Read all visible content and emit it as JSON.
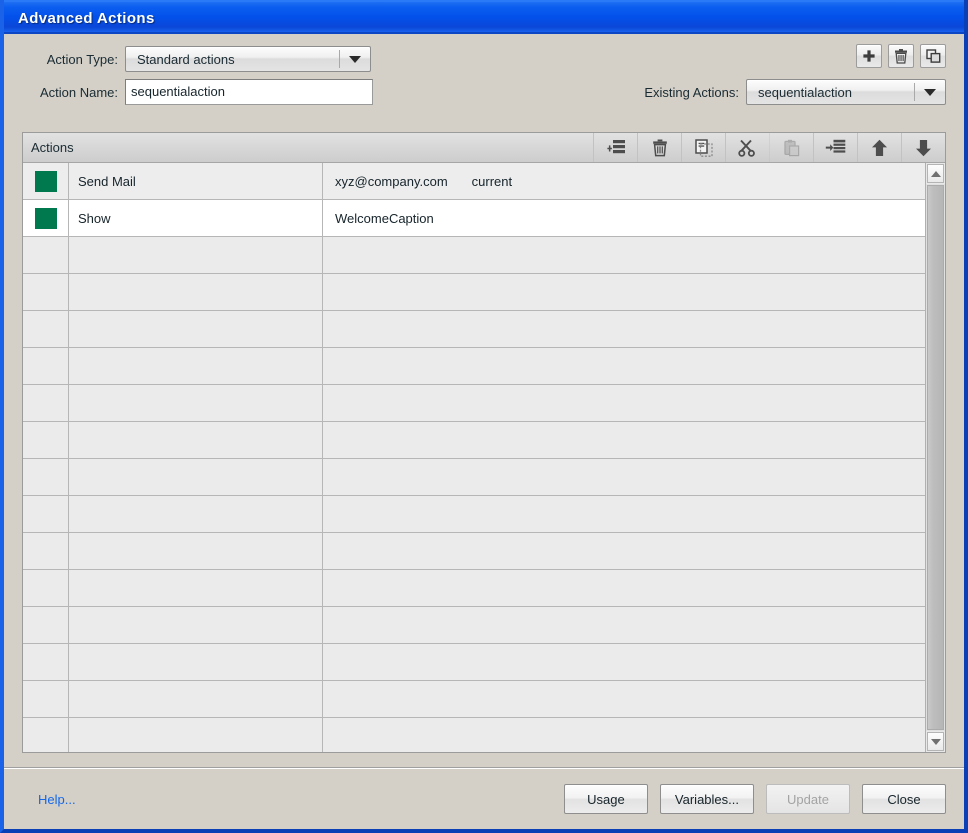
{
  "window": {
    "title": "Advanced Actions"
  },
  "form": {
    "action_type_label": "Action Type:",
    "action_type_value": "Standard actions",
    "action_name_label": "Action Name:",
    "action_name_value": "sequentialaction",
    "existing_actions_label": "Existing Actions:",
    "existing_actions_value": "sequentialaction",
    "top_buttons": [
      {
        "name": "add-action-button",
        "icon": "plus-icon"
      },
      {
        "name": "delete-action-button",
        "icon": "trash-icon"
      },
      {
        "name": "duplicate-action-button",
        "icon": "copy-windows-icon"
      }
    ]
  },
  "grid": {
    "title": "Actions",
    "tools": [
      {
        "name": "add-row-button",
        "icon": "add-row-icon",
        "enabled": true
      },
      {
        "name": "delete-row-button",
        "icon": "trash-icon",
        "enabled": true
      },
      {
        "name": "copy-row-button",
        "icon": "copy-icon",
        "enabled": true
      },
      {
        "name": "cut-row-button",
        "icon": "scissors-icon",
        "enabled": true
      },
      {
        "name": "paste-row-button",
        "icon": "paste-icon",
        "enabled": false
      },
      {
        "name": "insert-row-button",
        "icon": "insert-row-icon",
        "enabled": true
      },
      {
        "name": "move-up-button",
        "icon": "arrow-up-icon",
        "enabled": true
      },
      {
        "name": "move-down-button",
        "icon": "arrow-down-icon",
        "enabled": true
      }
    ],
    "swatch_color": "#00794e",
    "rows": [
      {
        "action": "Send Mail",
        "arg1": "xyz@company.com",
        "arg2": "current"
      },
      {
        "action": "Show",
        "arg1": "WelcomeCaption",
        "arg2": ""
      }
    ],
    "empty_row_count": 15
  },
  "footer": {
    "help_label": "Help...",
    "buttons": [
      {
        "label": "Usage",
        "name": "usage-button",
        "enabled": true
      },
      {
        "label": "Variables...",
        "name": "variables-button",
        "enabled": true
      },
      {
        "label": "Update",
        "name": "update-button",
        "enabled": false
      },
      {
        "label": "Close",
        "name": "close-button",
        "enabled": true
      }
    ]
  }
}
